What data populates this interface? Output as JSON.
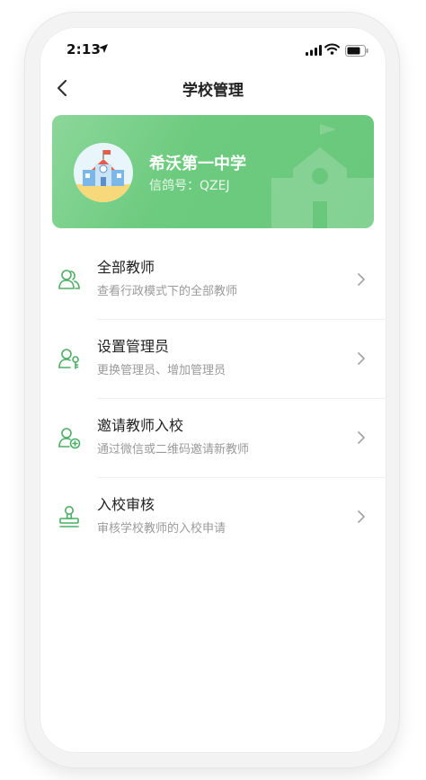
{
  "status_bar": {
    "time": "2:13"
  },
  "nav": {
    "title": "学校管理"
  },
  "school": {
    "name": "希沃第一中学",
    "code_label": "信鸽号：",
    "code_value": "QZEJ"
  },
  "menu": {
    "items": [
      {
        "title": "全部教师",
        "desc": "查看行政模式下的全部教师",
        "icon": "teachers-icon"
      },
      {
        "title": "设置管理员",
        "desc": "更换管理员、增加管理员",
        "icon": "admin-key-icon"
      },
      {
        "title": "邀请教师入校",
        "desc": "通过微信或二维码邀请新教师",
        "icon": "invite-teacher-icon"
      },
      {
        "title": "入校审核",
        "desc": "审核学校教师的入校申请",
        "icon": "stamp-icon"
      }
    ]
  },
  "colors": {
    "accent": "#6ac87c",
    "icon_green": "#4caf63"
  }
}
